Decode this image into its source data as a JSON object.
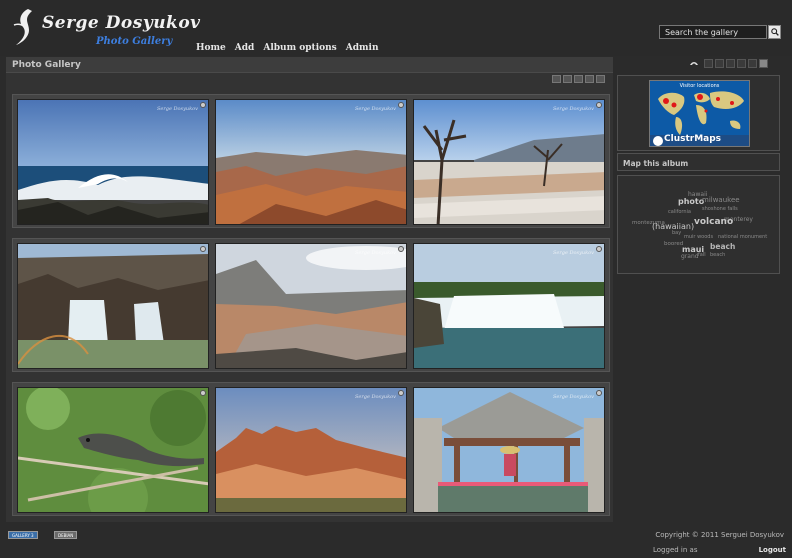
{
  "header": {
    "site_title": "Serge Dosyukov",
    "site_subtitle": "Photo Gallery",
    "nav": [
      "Home",
      "Add",
      "Album options",
      "Admin"
    ],
    "search_placeholder": "Search the gallery"
  },
  "main": {
    "title": "Photo Gallery",
    "watermark": "Serge Dosyukov",
    "photos": [
      {
        "name": "ocean-waves"
      },
      {
        "name": "grand-canyon"
      },
      {
        "name": "hot-springs-terraces"
      },
      {
        "name": "waterfall-gorge"
      },
      {
        "name": "volcanic-crater"
      },
      {
        "name": "niagara-falls"
      },
      {
        "name": "iguana"
      },
      {
        "name": "red-rock-cliffs"
      },
      {
        "name": "gazebo-balcony"
      }
    ]
  },
  "sidebar": {
    "map_label_top": "Visitor locations",
    "map_brand": "ClustrMaps",
    "map_album_title": "Map this album",
    "tags": [
      "hawaii",
      "photo",
      "milwaukee",
      "california",
      "shoshone falls",
      "monterey",
      "montezuma",
      "(hawaiian)",
      "volcano",
      "bay",
      "muir woods",
      "national monument",
      "beach",
      "boored",
      "maui",
      "grand",
      "fall",
      "beach"
    ]
  },
  "footer": {
    "badge_1": "GALLERY 3",
    "badge_2": "DEBIAN",
    "copyright": "Copyright © 2011 Serguei Dosyukov",
    "logged_in": "Logged in as",
    "logout": "Logout"
  },
  "colors": {
    "background": "#2b2b2b",
    "accent_blue": "#3d7fe0",
    "panel": "#333333"
  }
}
